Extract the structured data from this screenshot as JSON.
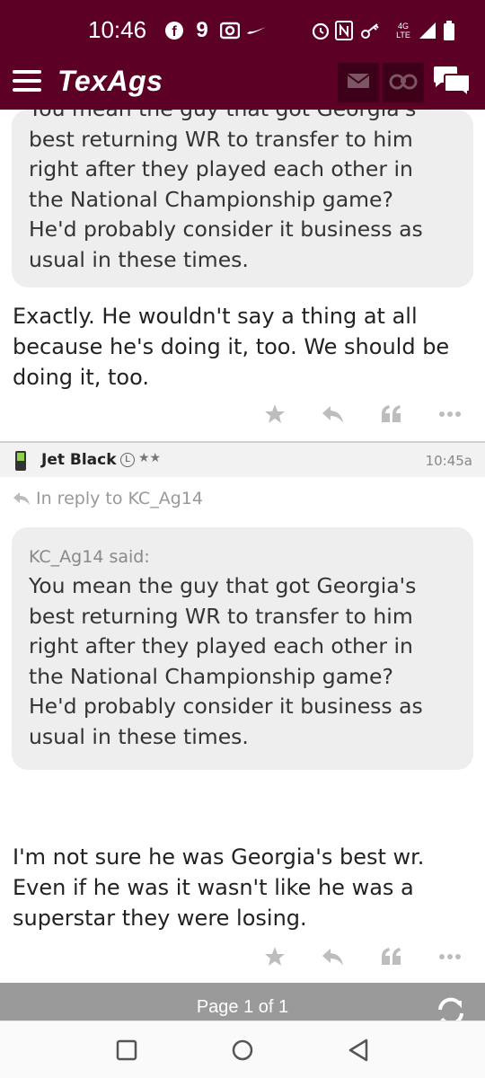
{
  "status_bar": {
    "time": "10:46",
    "network": "4G LTE"
  },
  "app": {
    "logo": "TexAgs",
    "brand_color": "#5d0025",
    "icons": [
      "menu-icon",
      "mail-icon",
      "binoculars-icon",
      "chat-icon"
    ]
  },
  "top_post": {
    "quote_lines": [
      "You mean the guy that got Georgia's",
      "best returning WR to transfer to him",
      "right after they played each other in",
      "the National Championship game?",
      "He'd probably consider it business as",
      "usual in these times."
    ],
    "body_lines": [
      "Exactly. He wouldn't say a thing at all",
      "because he's doing it, too. We should be",
      "doing it, too."
    ]
  },
  "post": {
    "author": "Jet Black",
    "badge": "L",
    "stars": "★★",
    "time": "10:45a",
    "reply_to": "In reply to KC_Ag14",
    "quote_attr": "KC_Ag14 said:",
    "quote_lines": [
      "You mean the guy that got Georgia's",
      "best returning WR to transfer to him",
      "right after they played each other in",
      "the National Championship game?",
      "He'd probably consider it business as",
      "usual in these times."
    ],
    "body_lines": [
      "I'm not sure he was Georgia's best wr.",
      "Even if he was it wasn't like he was a",
      "superstar they were losing."
    ]
  },
  "pagination": {
    "label": "Page 1 of 1"
  }
}
